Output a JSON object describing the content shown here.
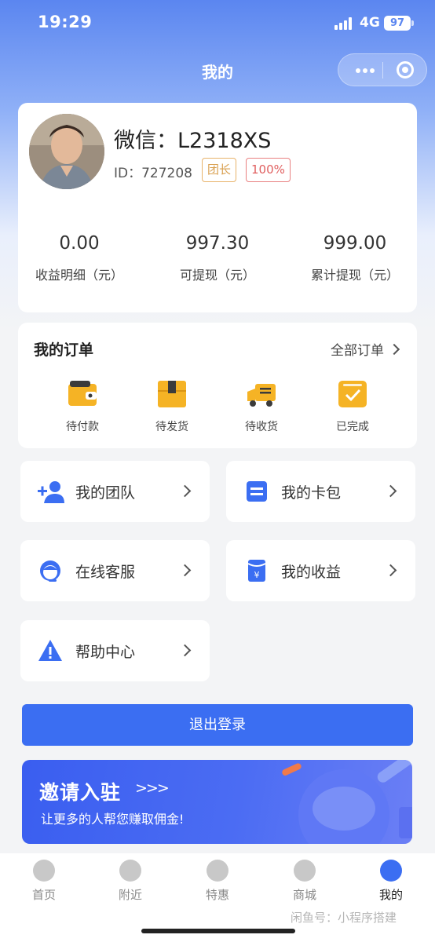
{
  "status_bar": {
    "time": "19:29",
    "network": "4G",
    "battery": "97"
  },
  "nav": {
    "title": "我的"
  },
  "profile": {
    "name": "微信：L2318XS",
    "id_label": "ID：727208",
    "role_badge": "团长",
    "percent_badge": "100%",
    "stats": [
      {
        "value": "0.00",
        "label": "收益明细（元）"
      },
      {
        "value": "997.30",
        "label": "可提现（元）"
      },
      {
        "value": "999.00",
        "label": "累计提现（元）"
      }
    ]
  },
  "orders": {
    "title": "我的订单",
    "all_label": "全部订单",
    "items": [
      {
        "label": "待付款",
        "icon": "wallet-icon"
      },
      {
        "label": "待发货",
        "icon": "box-icon"
      },
      {
        "label": "待收货",
        "icon": "truck-icon"
      },
      {
        "label": "已完成",
        "icon": "check-icon"
      }
    ]
  },
  "menu": {
    "team": "我的团队",
    "cards": "我的卡包",
    "service": "在线客服",
    "earnings": "我的收益",
    "help": "帮助中心"
  },
  "logout_label": "退出登录",
  "invite": {
    "title": "邀请入驻",
    "arrow": ">>>",
    "subtitle": "让更多的人帮您赚取佣金!"
  },
  "tabbar": [
    {
      "label": "首页",
      "icon": "home-icon"
    },
    {
      "label": "附近",
      "icon": "location-icon"
    },
    {
      "label": "特惠",
      "icon": "award-icon"
    },
    {
      "label": "商城",
      "icon": "shop-icon"
    },
    {
      "label": "我的",
      "icon": "user-icon"
    }
  ],
  "watermark": "闲鱼号：小程序搭建",
  "colors": {
    "primary": "#3b6ef2",
    "accent_orange": "#f5b325",
    "badge_gold": "#d9a050",
    "badge_red": "#e06060"
  }
}
